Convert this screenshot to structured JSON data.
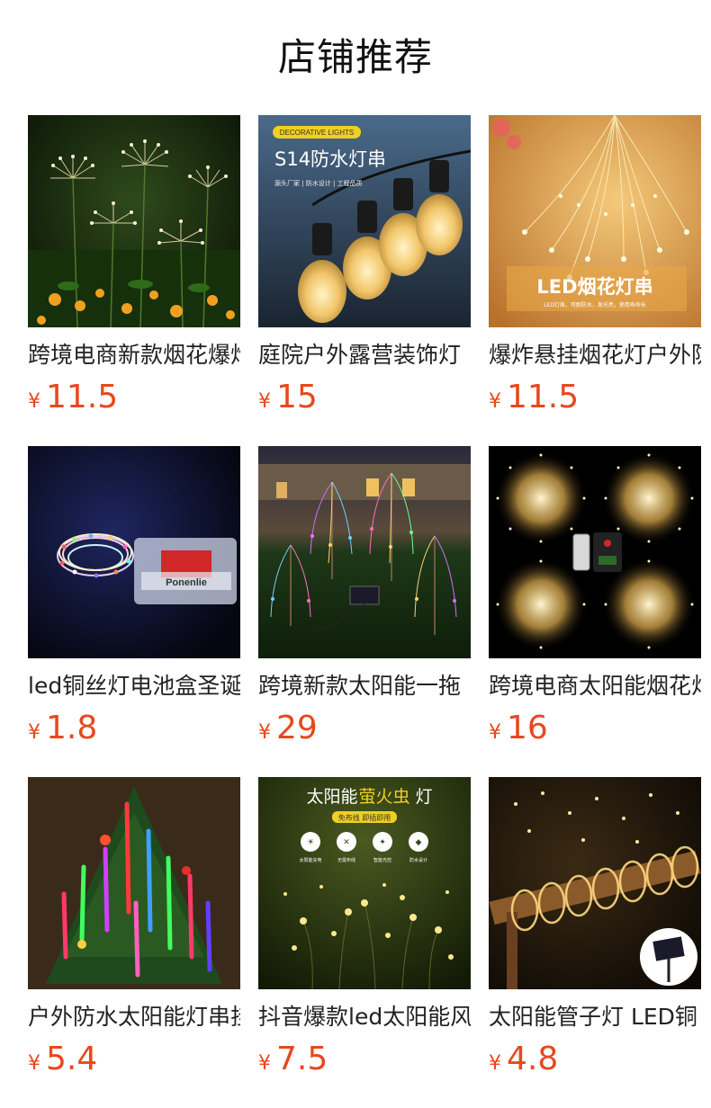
{
  "section": {
    "title": "店铺推荐"
  },
  "currency_symbol": "¥",
  "colors": {
    "price": "#e8481c",
    "title": "#111111",
    "text": "#222222"
  },
  "products": [
    {
      "name": "跨境电商新款烟花爆炸灯",
      "price": "11.5",
      "image": "firework-lights-garden-image"
    },
    {
      "name": "庭院户外露营装饰灯",
      "price": "15",
      "image": "s14-string-lights-image"
    },
    {
      "name": "爆炸悬挂烟花灯户外防水",
      "price": "11.5",
      "image": "led-firework-string-image"
    },
    {
      "name": "led铜丝灯电池盒圣诞",
      "price": "1.8",
      "image": "copper-wire-battery-box-image"
    },
    {
      "name": "跨境新款太阳能一拖",
      "price": "29",
      "image": "solar-willow-lights-image"
    },
    {
      "name": "跨境电商太阳能烟花灯",
      "price": "16",
      "image": "solar-firework-remote-image"
    },
    {
      "name": "户外防水太阳能灯串挂",
      "price": "5.4",
      "image": "meteor-tree-lights-image"
    },
    {
      "name": "抖音爆款led太阳能风",
      "price": "7.5",
      "image": "solar-firefly-lights-image"
    },
    {
      "name": "太阳能管子灯 LED铜",
      "price": "4.8",
      "image": "solar-tube-lights-image"
    }
  ],
  "image_text": {
    "s14_badge": "DECORATIVE LIGHTS",
    "s14_title": "S14防水灯串",
    "s14_sub": "源头厂家 | 防水设计 | 工程品质",
    "led_firework_title": "LED烟花灯串",
    "led_firework_sub": "LED灯珠，可耐防水，发光亮，使用寿命长",
    "firefly_title_a": "太阳能",
    "firefly_title_b": "萤火虫",
    "firefly_title_c": "灯",
    "firefly_tag": "免布线 即插即用",
    "firefly_feat_1": "太阳能充电",
    "firefly_feat_2": "无需布线",
    "firefly_feat_3": "智能光控",
    "firefly_feat_4": "防水设计",
    "battery_box_text": "Ponenlie"
  }
}
